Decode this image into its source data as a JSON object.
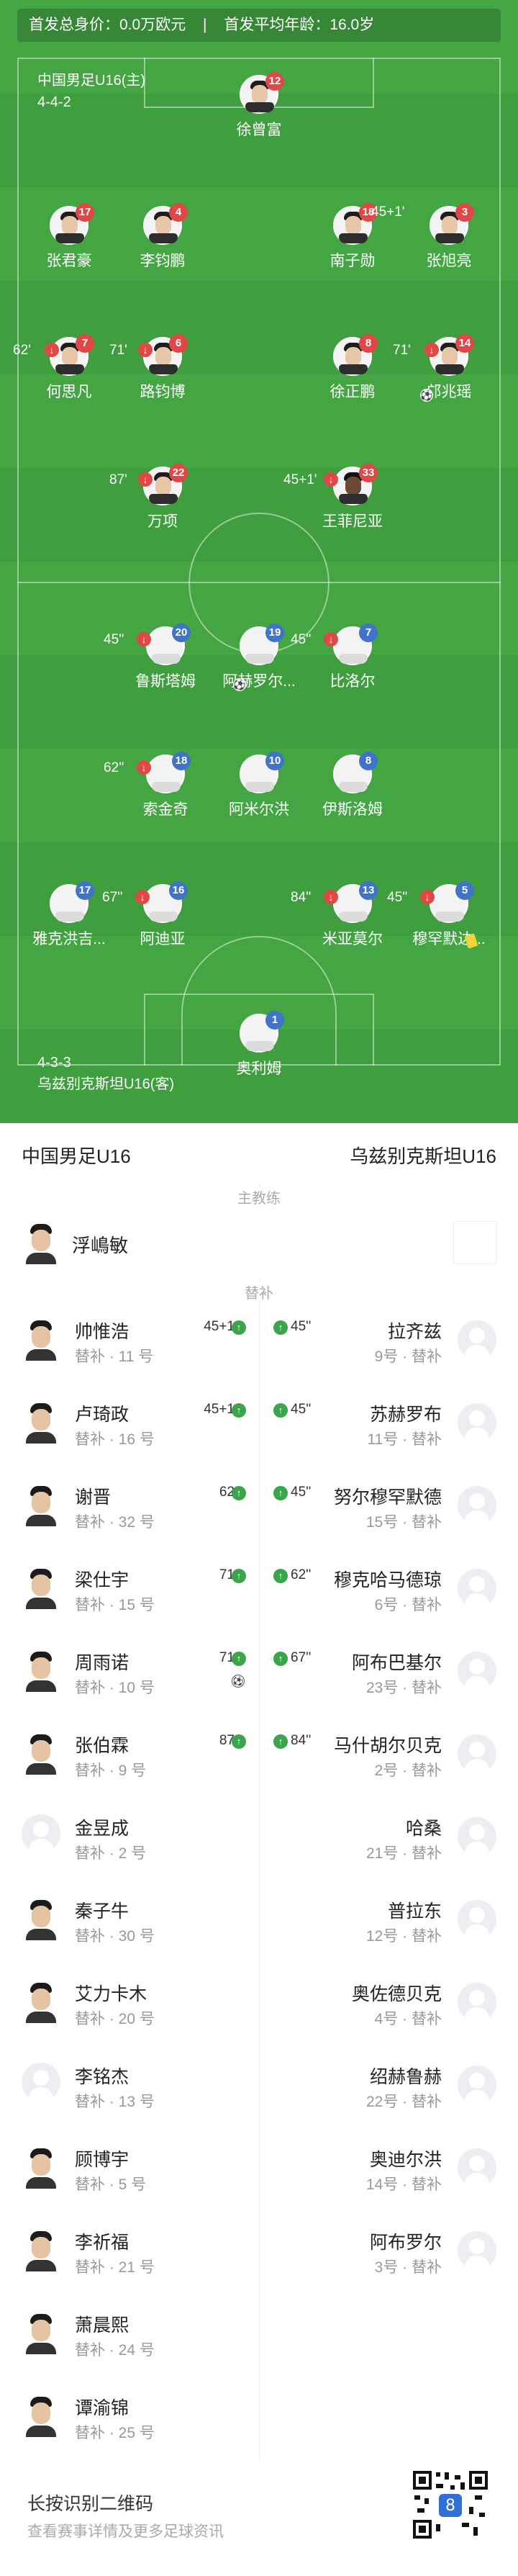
{
  "summary": {
    "value_label": "首发总身价：",
    "value": "0.0万欧元",
    "age_label": "首发平均年龄：",
    "age": "16.0岁"
  },
  "home": {
    "name": "中国男足U16(主)",
    "formation": "4-4-2",
    "players": [
      {
        "name": "徐曾富",
        "number": "12"
      },
      {
        "name": "张君豪",
        "number": "17"
      },
      {
        "name": "李钧鹏",
        "number": "4"
      },
      {
        "name": "南子勋",
        "number": "18",
        "sub": "45+1'"
      },
      {
        "name": "张旭亮",
        "number": "3"
      },
      {
        "name": "何思凡",
        "number": "7",
        "sub": "62'"
      },
      {
        "name": "路钧博",
        "number": "6",
        "sub": "71'"
      },
      {
        "name": "徐正鹏",
        "number": "8"
      },
      {
        "name": "邝兆瑶",
        "number": "14",
        "sub": "71'"
      },
      {
        "name": "万项",
        "number": "22",
        "sub": "87'"
      },
      {
        "name": "王菲尼亚",
        "number": "33",
        "sub": "45+1'"
      }
    ]
  },
  "away": {
    "name": "乌兹别克斯坦U16(客)",
    "formation": "4-3-3",
    "players": [
      {
        "name": "鲁斯塔姆",
        "number": "20",
        "sub": "45''"
      },
      {
        "name": "阿赫罗尔...",
        "number": "19"
      },
      {
        "name": "比洛尔",
        "number": "7",
        "sub": "45''"
      },
      {
        "name": "索金奇",
        "number": "18",
        "sub": "62''"
      },
      {
        "name": "阿米尔洪",
        "number": "10"
      },
      {
        "name": "伊斯洛姆",
        "number": "8"
      },
      {
        "name": "雅克洪吉...",
        "number": "17"
      },
      {
        "name": "阿迪亚",
        "number": "16",
        "sub": "67''"
      },
      {
        "name": "米亚莫尔",
        "number": "13",
        "sub": "84''"
      },
      {
        "name": "穆罕默达...",
        "number": "5",
        "sub": "45''"
      },
      {
        "name": "奥利姆",
        "number": "1"
      }
    ]
  },
  "lists": {
    "home_team": "中国男足U16",
    "away_team": "乌兹别克斯坦U16",
    "coach_title": "主教练",
    "home_coach": "浮嶋敏",
    "subs_title": "替补",
    "subs": [
      {
        "l_name": "帅惟浩",
        "l_meta": "替补 · 11 号",
        "l_time": "45+1",
        "r_time": "45''",
        "r_name": "拉齐兹",
        "r_meta": "9号 · 替补"
      },
      {
        "l_name": "卢琦政",
        "l_meta": "替补 · 16 号",
        "l_time": "45+1",
        "r_time": "45''",
        "r_name": "苏赫罗布",
        "r_meta": "11号 · 替补"
      },
      {
        "l_name": "谢晋",
        "l_meta": "替补 · 32 号",
        "l_time": "62",
        "r_time": "45''",
        "r_name": "努尔穆罕默德",
        "r_meta": "15号 · 替补"
      },
      {
        "l_name": "梁仕宇",
        "l_meta": "替补 · 15 号",
        "l_time": "71",
        "r_time": "62''",
        "r_name": "穆克哈马德琼",
        "r_meta": "6号 · 替补"
      },
      {
        "l_name": "周雨诺",
        "l_meta": "替补 · 10 号",
        "l_time": "71",
        "r_time": "67''",
        "r_name": "阿布巴基尔",
        "r_meta": "23号 · 替补"
      },
      {
        "l_name": "张伯霖",
        "l_meta": "替补 · 9 号",
        "l_time": "87",
        "r_time": "84''",
        "r_name": "马什胡尔贝克",
        "r_meta": "2号 · 替补"
      },
      {
        "l_name": "金昱成",
        "l_meta": "替补 · 2 号",
        "l_time": "",
        "r_time": "",
        "r_name": "哈桑",
        "r_meta": "21号 · 替补"
      },
      {
        "l_name": "秦子牛",
        "l_meta": "替补 · 30 号",
        "l_time": "",
        "r_time": "",
        "r_name": "普拉东",
        "r_meta": "12号 · 替补"
      },
      {
        "l_name": "艾力卡木",
        "l_meta": "替补 · 20 号",
        "l_time": "",
        "r_time": "",
        "r_name": "奥佐德贝克",
        "r_meta": "4号 · 替补"
      },
      {
        "l_name": "李铭杰",
        "l_meta": "替补 · 13 号",
        "l_time": "",
        "r_time": "",
        "r_name": "绍赫鲁赫",
        "r_meta": "22号 · 替补"
      },
      {
        "l_name": "顾博宇",
        "l_meta": "替补 · 5 号",
        "l_time": "",
        "r_time": "",
        "r_name": "奥迪尔洪",
        "r_meta": "14号 · 替补"
      },
      {
        "l_name": "李祈福",
        "l_meta": "替补 · 21 号",
        "l_time": "",
        "r_time": "",
        "r_name": "阿布罗尔",
        "r_meta": "3号 · 替补"
      },
      {
        "l_name": "萧晨熙",
        "l_meta": "替补 · 24 号",
        "l_time": "",
        "r_time": "",
        "r_name": "",
        "r_meta": ""
      },
      {
        "l_name": "谭渝锦",
        "l_meta": "替补 · 25 号",
        "l_time": "",
        "r_time": "",
        "r_name": "",
        "r_meta": ""
      }
    ]
  },
  "footer": {
    "hint": "长按识别二维码",
    "hint2": "查看赛事详情及更多足球资讯"
  },
  "colors": {
    "pitch": "#3f9f3f",
    "home_num": "#e04848",
    "away_num": "#3f74c9",
    "sub_in": "#3aa54b"
  }
}
